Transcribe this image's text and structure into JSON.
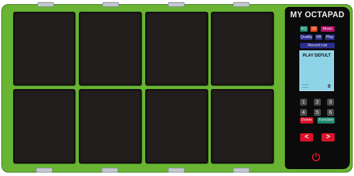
{
  "app": {
    "title": "MY OCTAPAD"
  },
  "pads": [
    "pad-1",
    "pad-2",
    "pad-3",
    "pad-4",
    "pad-5",
    "pad-6",
    "pad-7",
    "pad-8"
  ],
  "controls": {
    "row1": [
      {
        "label": "EQ",
        "color": "#1f8a70"
      },
      {
        "label": "UI",
        "color": "#e04a1b"
      },
      {
        "label": "Music",
        "color": "#b0126a"
      }
    ],
    "row2": [
      {
        "label": "Quality",
        "color": "#2b2f8f"
      },
      {
        "label": "KB",
        "color": "#2b2f8f"
      },
      {
        "label": "Play",
        "color": "#2b2f8f"
      }
    ],
    "record": {
      "label": "Record List",
      "color": "#2b2f8f"
    }
  },
  "display": {
    "mode": "PLAY DEFULT",
    "count": "0"
  },
  "numbers": [
    "1",
    "2",
    "3",
    "4",
    "5",
    "6"
  ],
  "actions": {
    "delete": "Delete",
    "function": "Function"
  },
  "nav": {
    "prev": "<",
    "next": ">"
  },
  "icons": {
    "power": "power-icon"
  }
}
